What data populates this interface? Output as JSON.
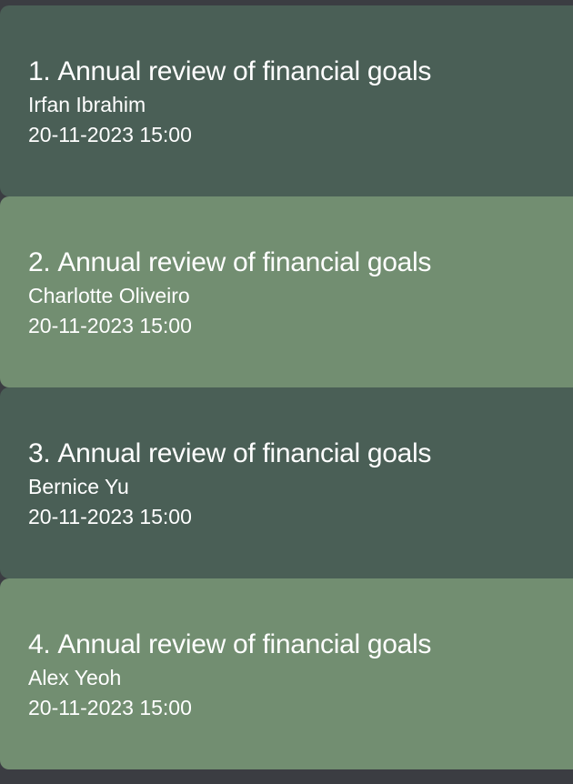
{
  "meetings": [
    {
      "index": "1.",
      "title": "Annual review of financial goals",
      "client": "Irfan Ibrahim",
      "datetime": "20-11-2023 15:00",
      "color": "#4a5f56"
    },
    {
      "index": "2.",
      "title": "Annual review of financial goals",
      "client": "Charlotte Oliveiro",
      "datetime": "20-11-2023 15:00",
      "color": "#728e71"
    },
    {
      "index": "3.",
      "title": "Annual review of financial goals",
      "client": "Bernice Yu",
      "datetime": "20-11-2023 15:00",
      "color": "#4a5f56"
    },
    {
      "index": "4.",
      "title": "Annual review of financial goals",
      "client": "Alex Yeoh",
      "datetime": "20-11-2023 15:00",
      "color": "#728e71"
    }
  ],
  "background_color": "#3b3d42"
}
